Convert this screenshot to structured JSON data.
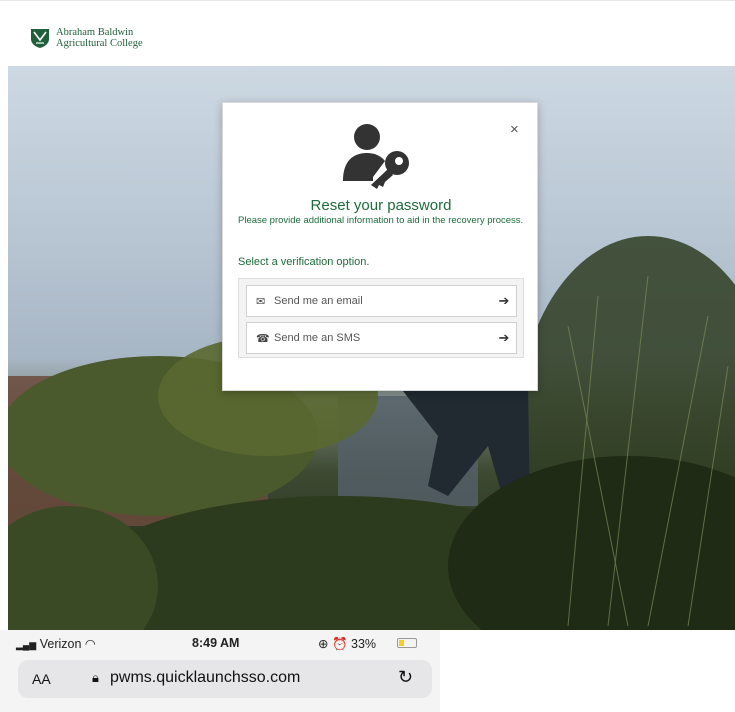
{
  "header": {
    "logo_line1": "Abraham Baldwin",
    "logo_line2": "Agricultural College"
  },
  "modal": {
    "close_label": "×",
    "title": "Reset your password",
    "description": "Please provide additional information to aid in the recovery process.",
    "prompt": "Select a verification option.",
    "options": [
      {
        "icon": "envelope-icon",
        "label": "Send me an email",
        "arrow": "➔"
      },
      {
        "icon": "phone-icon",
        "label": "Send me an SMS",
        "arrow": "➔"
      }
    ]
  },
  "status_bar": {
    "carrier": "Verizon",
    "time": "8:49 AM",
    "battery": "33%",
    "battery_level": 0.33
  },
  "browser": {
    "text_size": "AA",
    "url": "pwms.quicklaunchsso.com"
  },
  "colors": {
    "brand_green": "#1e6b3c"
  }
}
